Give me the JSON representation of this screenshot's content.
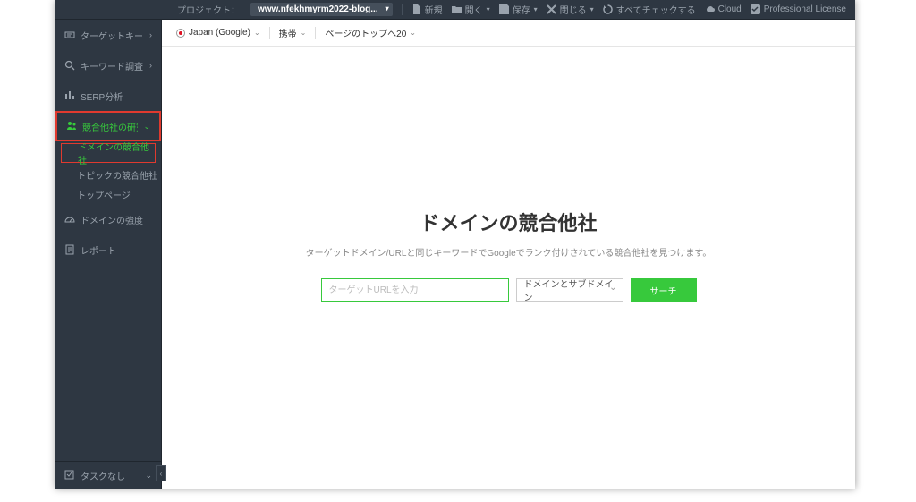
{
  "topbar": {
    "project_label": "プロジェクト：",
    "project_name": "www.nfekhmyrm2022-blog...",
    "new": "新規",
    "open": "開く",
    "save": "保存",
    "close": "閉じる",
    "check_all": "すべてチェックする",
    "cloud": "Cloud",
    "license": "Professional License"
  },
  "sidebar": {
    "items": [
      {
        "label": "ターゲットキーワード"
      },
      {
        "label": "キーワード調査"
      },
      {
        "label": "SERP分析"
      },
      {
        "label": "競合他社の研究"
      },
      {
        "label": "ドメインの強度"
      },
      {
        "label": "レポート"
      }
    ],
    "subitems": [
      {
        "label": "ドメインの競合他社"
      },
      {
        "label": "トピックの競合他社"
      },
      {
        "label": "トップページ"
      }
    ],
    "tasks": "タスクなし"
  },
  "crumb": {
    "region": "Japan (Google)",
    "device": "携帯",
    "top": "ページのトップへ20"
  },
  "hero": {
    "title": "ドメインの競合他社",
    "subtitle": "ターゲットドメイン/URLと同じキーワードでGoogleでランク付けされている競合他社を見つけます。",
    "placeholder": "ターゲットURLを入力",
    "scope": "ドメインとサブドメイン",
    "search": "サーチ"
  }
}
